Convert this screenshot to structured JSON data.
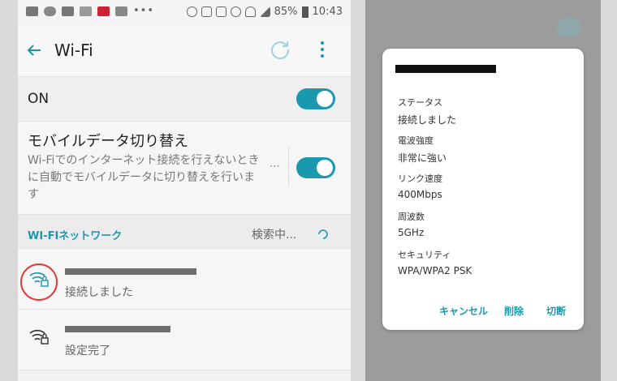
{
  "status_bar": {
    "battery": "85%",
    "time": "10:43",
    "dots": "•••"
  },
  "app_bar": {
    "title": "Wi-Fi"
  },
  "wifi_toggle": {
    "label": "ON",
    "state": "on"
  },
  "mobile_switch": {
    "title": "モバイルデータ切り替え",
    "description": "Wi-Fiでのインターネット接続を行えないときに自動でモバイルデータに切り替えを行います",
    "dots": "⋯",
    "state": "on"
  },
  "networks_section": {
    "header": "WI-FIネットワーク",
    "scanning": "検索中..."
  },
  "networks": [
    {
      "name_redacted": true,
      "status": "接続しました",
      "secured": true,
      "highlighted": true
    },
    {
      "name_redacted": true,
      "status": "設定完了",
      "secured": true,
      "highlighted": false
    }
  ],
  "dialog": {
    "title_redacted": true,
    "fields": [
      {
        "label": "ステータス",
        "value": "接続しました"
      },
      {
        "label": "電波強度",
        "value": "非常に強い"
      },
      {
        "label": "リンク速度",
        "value": "400Mbps"
      },
      {
        "label": "周波数",
        "value": "5GHz"
      },
      {
        "label": "セキュリティ",
        "value": "WPA/WPA2 PSK"
      }
    ],
    "actions": {
      "cancel": "キャンセル",
      "delete": "削除",
      "disconnect": "切断"
    }
  },
  "colors": {
    "accent": "#1a98ad",
    "highlight_circle": "#e23a3a"
  }
}
